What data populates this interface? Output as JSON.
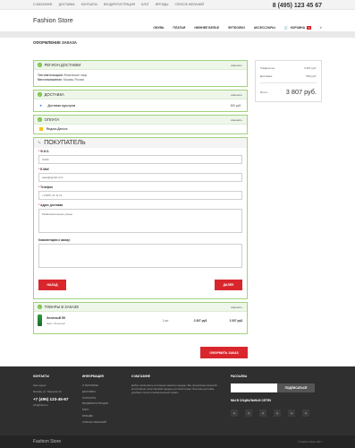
{
  "topbar": {
    "links": [
      "О МАГАЗИНЕ",
      "ДОСТАВКА",
      "КОНТАКТЫ",
      "ВХОД/РЕГИСТРАЦИЯ",
      "БЛОГ",
      "ВРЕНДЫ",
      "СПИСОК ЖЕЛАНИЙ"
    ]
  },
  "header": {
    "logo": "Fashion Store",
    "phone": "8 (495) 123 45 67",
    "nav": [
      "ОБУВЬ",
      "ПЛАТЬЯ",
      "НИЖНЕЕ БЕЛЬЕ",
      "ФУТБОЛКИ",
      "АКСЕССУАРЫ"
    ],
    "cart_label": "КОРЗИНА",
    "cart_count": "1"
  },
  "page_title": "ОФОРМЛЕНИЕ ЗАКАЗА",
  "region": {
    "title": "РЕГИОН ДОСТАВКИ",
    "change": "изменить",
    "payer_key": "Тип плательщика:",
    "payer_val": "Физическое лицо",
    "location_key": "Местоположение:",
    "location_val": "Москва, Россия"
  },
  "delivery": {
    "title": "ДОСТАВКА",
    "change": "изменить",
    "name": "Доставка курьером",
    "price": "500 руб."
  },
  "payment": {
    "title": "ОПЛАТА",
    "change": "изменить",
    "name": "Яндекс.Деньги"
  },
  "buyer": {
    "title": "ПОКУПАТЕЛЬ",
    "fio_label": "Ф.И.О.",
    "fio_value": "Kartik",
    "email_label": "E-Mail",
    "email_value": "aaaa@gmail.com",
    "phone_label": "Телефон",
    "phone_value": "+7(987) 11 11 11",
    "address_label": "Адрес доставки",
    "address_value": "Развлекательные улицы",
    "comment_label": "Комментарии к заказу:",
    "back": "НАЗАД",
    "next": "ДАЛЕЕ"
  },
  "goods": {
    "title": "ТОВАРЫ В ЗАКАЗЕ",
    "change": "изменить",
    "name": "Зеленый 55",
    "sub": "Цвет: Зеленый",
    "qty": "1 шт",
    "price": "3 307 руб.",
    "sum": "3 307 руб."
  },
  "order_button": "ОФОРМИТЬ ЗАКАЗ",
  "summary": {
    "goods_key": "Товаров на:",
    "goods_val": "3 307 руб.",
    "delivery_key": "Доставка:",
    "delivery_val": "500 руб.",
    "total_key": "Итого:",
    "total_val": "3 807 руб."
  },
  "footer": {
    "contacts_title": "КОНТАКТЫ",
    "contacts_lines": [
      "Наш адрес:",
      "Москва, ул. Тверская 12"
    ],
    "phone": "+7 (495) 123-45-67",
    "email": "info@shop.ru",
    "info_title": "ИНФОРМАЦИЯ",
    "info_links": [
      "О МАГАЗИНЕ",
      "ДОСТАВКА",
      "КОНТАКТЫ",
      "ВХОД/РЕГИСТРАЦИЯ",
      "БЛОГ",
      "БРЕНДЫ",
      "СПИСОК ЖЕЛАНИЙ"
    ],
    "about_title": "О МАГАЗИНЕ",
    "about_text": "Добро пожаловать в интернет-магазин одежды. Мы предлагаем широкий ассортимент качественной одежды для всей семьи. Быстрая доставка, удобная оплата и внимательный сервис.",
    "subscribe_title": "РАССЫЛКА",
    "subscribe_btn": "ПОДПИСАТЬСЯ",
    "social_title": "МЫ В СОЦИАЛЬНЫХ СЕТЯХ",
    "social_icons": [
      "vk",
      "fb",
      "tw",
      "gp",
      "ig",
      "yt"
    ],
    "bottom_logo": "Fashion Store",
    "copyright": "© Fashion Store 2017"
  }
}
